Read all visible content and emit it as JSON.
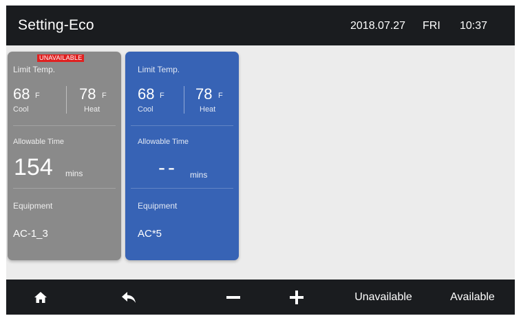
{
  "header": {
    "title": "Setting-Eco",
    "date": "2018.07.27",
    "day": "FRI",
    "time": "10:37"
  },
  "cards": [
    {
      "badge": "UNAVAILABLE",
      "limit_label": "Limit Temp.",
      "cool_value": "68",
      "cool_unit": "F",
      "cool_label": "Cool",
      "heat_value": "78",
      "heat_unit": "F",
      "heat_label": "Heat",
      "time_label": "Allowable Time",
      "time_value": "154",
      "time_unit": "mins",
      "equipment_label": "Equipment",
      "equipment_value": "AC-1_3",
      "background": "#8a8a8a"
    },
    {
      "limit_label": "Limit Temp.",
      "cool_value": "68",
      "cool_unit": "F",
      "cool_label": "Cool",
      "heat_value": "78",
      "heat_unit": "F",
      "heat_label": "Heat",
      "time_label": "Allowable Time",
      "time_value": "--",
      "time_unit": "mins",
      "equipment_label": "Equipment",
      "equipment_value": "AC*5",
      "background": "#3763b5"
    }
  ],
  "footer": {
    "icons": [
      "home-icon",
      "back-icon",
      "minus-icon",
      "plus-icon"
    ],
    "unavailable_label": "Unavailable",
    "available_label": "Available"
  },
  "colors": {
    "bar_background": "#1a1c1f",
    "content_background": "#ececec",
    "badge_red": "#e02020"
  }
}
